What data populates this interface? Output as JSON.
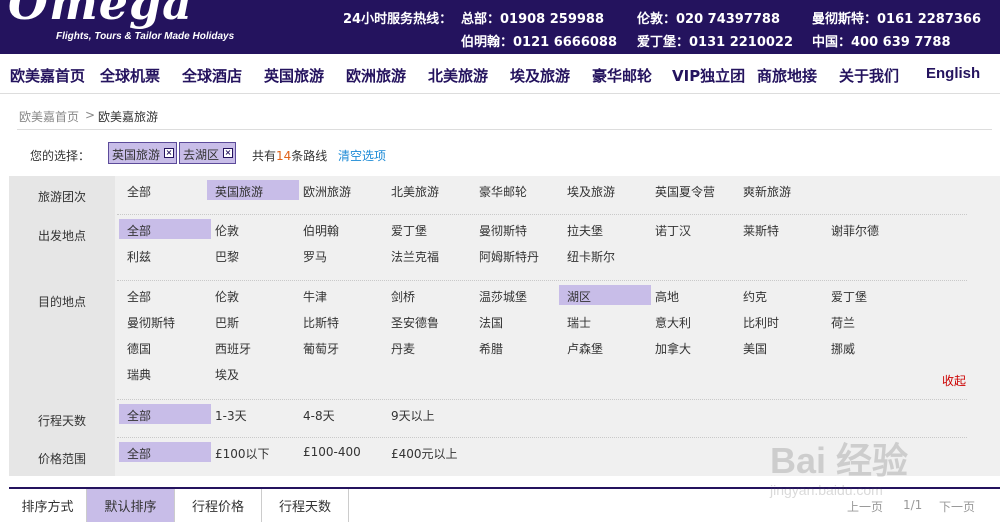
{
  "header": {
    "logo_text": "Omega",
    "tagline": "Flights, Tours & Tailor Made Holidays",
    "hotline_label": "24小时服务热线：",
    "hotlines": [
      "总部：01908 259988",
      "伦敦：020 74397788",
      "曼彻斯特：0161 2287366",
      "伯明翰：0121 6666088",
      "爱丁堡：0131 2210022",
      "中国：400 639 7788"
    ]
  },
  "nav": {
    "items": [
      "欧美嘉首页",
      "全球机票",
      "全球酒店",
      "英国旅游",
      "欧洲旅游",
      "北美旅游",
      "埃及旅游",
      "豪华邮轮",
      "VIP独立团",
      "商旅地接",
      "关于我们",
      "English"
    ]
  },
  "breadcrumb": {
    "home": "欧美嘉首页",
    "separator": ">",
    "current": "欧美嘉旅游"
  },
  "selection": {
    "label": "您的选择：",
    "chips": [
      "英国旅游",
      "去湖区"
    ],
    "chip_remove": "×",
    "count_prefix": "共有",
    "count": "14",
    "count_suffix": "条路线",
    "clear": "清空选项"
  },
  "filters": {
    "tour_type": {
      "label": "旅游团次",
      "options": [
        "全部",
        "英国旅游",
        "欧洲旅游",
        "北美旅游",
        "豪华邮轮",
        "埃及旅游",
        "英国夏令营",
        "爽新旅游"
      ],
      "selected": "英国旅游"
    },
    "departure": {
      "label": "出发地点",
      "options": [
        "全部",
        "伦敦",
        "伯明翰",
        "爱丁堡",
        "曼彻斯特",
        "拉夫堡",
        "诺丁汉",
        "莱斯特",
        "谢菲尔德",
        "利兹",
        "巴黎",
        "罗马",
        "法兰克福",
        "阿姆斯特丹",
        "纽卡斯尔"
      ],
      "selected": "全部"
    },
    "destination": {
      "label": "目的地点",
      "options": [
        "全部",
        "伦敦",
        "牛津",
        "剑桥",
        "温莎城堡",
        "湖区",
        "高地",
        "约克",
        "爱丁堡",
        "曼彻斯特",
        "巴斯",
        "比斯特",
        "圣安德鲁",
        "法国",
        "瑞士",
        "意大利",
        "比利时",
        "荷兰",
        "德国",
        "西班牙",
        "葡萄牙",
        "丹麦",
        "希腊",
        "卢森堡",
        "加拿大",
        "美国",
        "挪威",
        "瑞典",
        "埃及"
      ],
      "selected": "湖区",
      "collapse": "收起"
    },
    "days": {
      "label": "行程天数",
      "options": [
        "全部",
        "1-3天",
        "4-8天",
        "9天以上"
      ],
      "selected": "全部"
    },
    "price": {
      "label": "价格范围",
      "options": [
        "全部",
        "£100以下",
        "£100-400",
        "£400元以上"
      ],
      "selected": "全部"
    }
  },
  "sort": {
    "label": "排序方式",
    "tabs": [
      "默认排序",
      "行程价格",
      "行程天数"
    ],
    "active": "默认排序",
    "prev": "上一页",
    "page": "1/1",
    "next": "下一页"
  },
  "watermark": {
    "text": "Bai 经验",
    "sub": "jingyan.baidu.com"
  },
  "colors": {
    "brand": "#24135e",
    "selected_bg": "#c8bde8",
    "count": "#e0631a",
    "link": "#1c8ad6",
    "collapse": "#cc0000"
  }
}
